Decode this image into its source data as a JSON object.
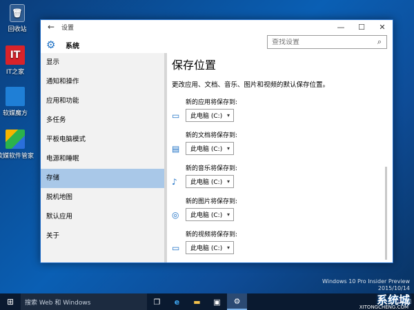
{
  "desktop": {
    "icons": [
      {
        "label": "回收站"
      },
      {
        "label": "IT之家",
        "badge": "IT"
      },
      {
        "label": "软媒魔方"
      },
      {
        "label": "软媒软件管家"
      }
    ]
  },
  "window": {
    "title": "设置",
    "back": "←",
    "minimize": "—",
    "maximize": "☐",
    "close": "✕",
    "section_title": "系统",
    "search_placeholder": "查找设置"
  },
  "sidebar": {
    "items": [
      {
        "label": "显示"
      },
      {
        "label": "通知和操作"
      },
      {
        "label": "应用和功能"
      },
      {
        "label": "多任务"
      },
      {
        "label": "平板电脑模式"
      },
      {
        "label": "电源和睡眠"
      },
      {
        "label": "存储"
      },
      {
        "label": "脱机地图"
      },
      {
        "label": "默认应用"
      },
      {
        "label": "关于"
      }
    ],
    "active_index": 6
  },
  "content": {
    "title": "保存位置",
    "description": "更改应用、文档、音乐、图片和视频的默认保存位置。",
    "groups": [
      {
        "label": "新的应用将保存到:",
        "value": "此电脑 (C:)",
        "icon": "monitor-icon"
      },
      {
        "label": "新的文档将保存到:",
        "value": "此电脑 (C:)",
        "icon": "folder-icon"
      },
      {
        "label": "新的音乐将保存到:",
        "value": "此电脑 (C:)",
        "icon": "music-icon"
      },
      {
        "label": "新的图片将保存到:",
        "value": "此电脑 (C:)",
        "icon": "camera-icon"
      },
      {
        "label": "新的视频将保存到:",
        "value": "此电脑 (C:)",
        "icon": "video-icon"
      }
    ]
  },
  "taskbar": {
    "search_text": "搜索 Web 和 Windows"
  },
  "watermark": {
    "line1": "Windows 10 Pro Insider Preview",
    "line2": "2015/10/14",
    "logo": "系统城",
    "logo_url": "XITONGCHENG.COM"
  },
  "colors": {
    "accent": "#1b6fc4",
    "active_nav": "#a9c8e8",
    "taskbar": "#0a1a30"
  }
}
